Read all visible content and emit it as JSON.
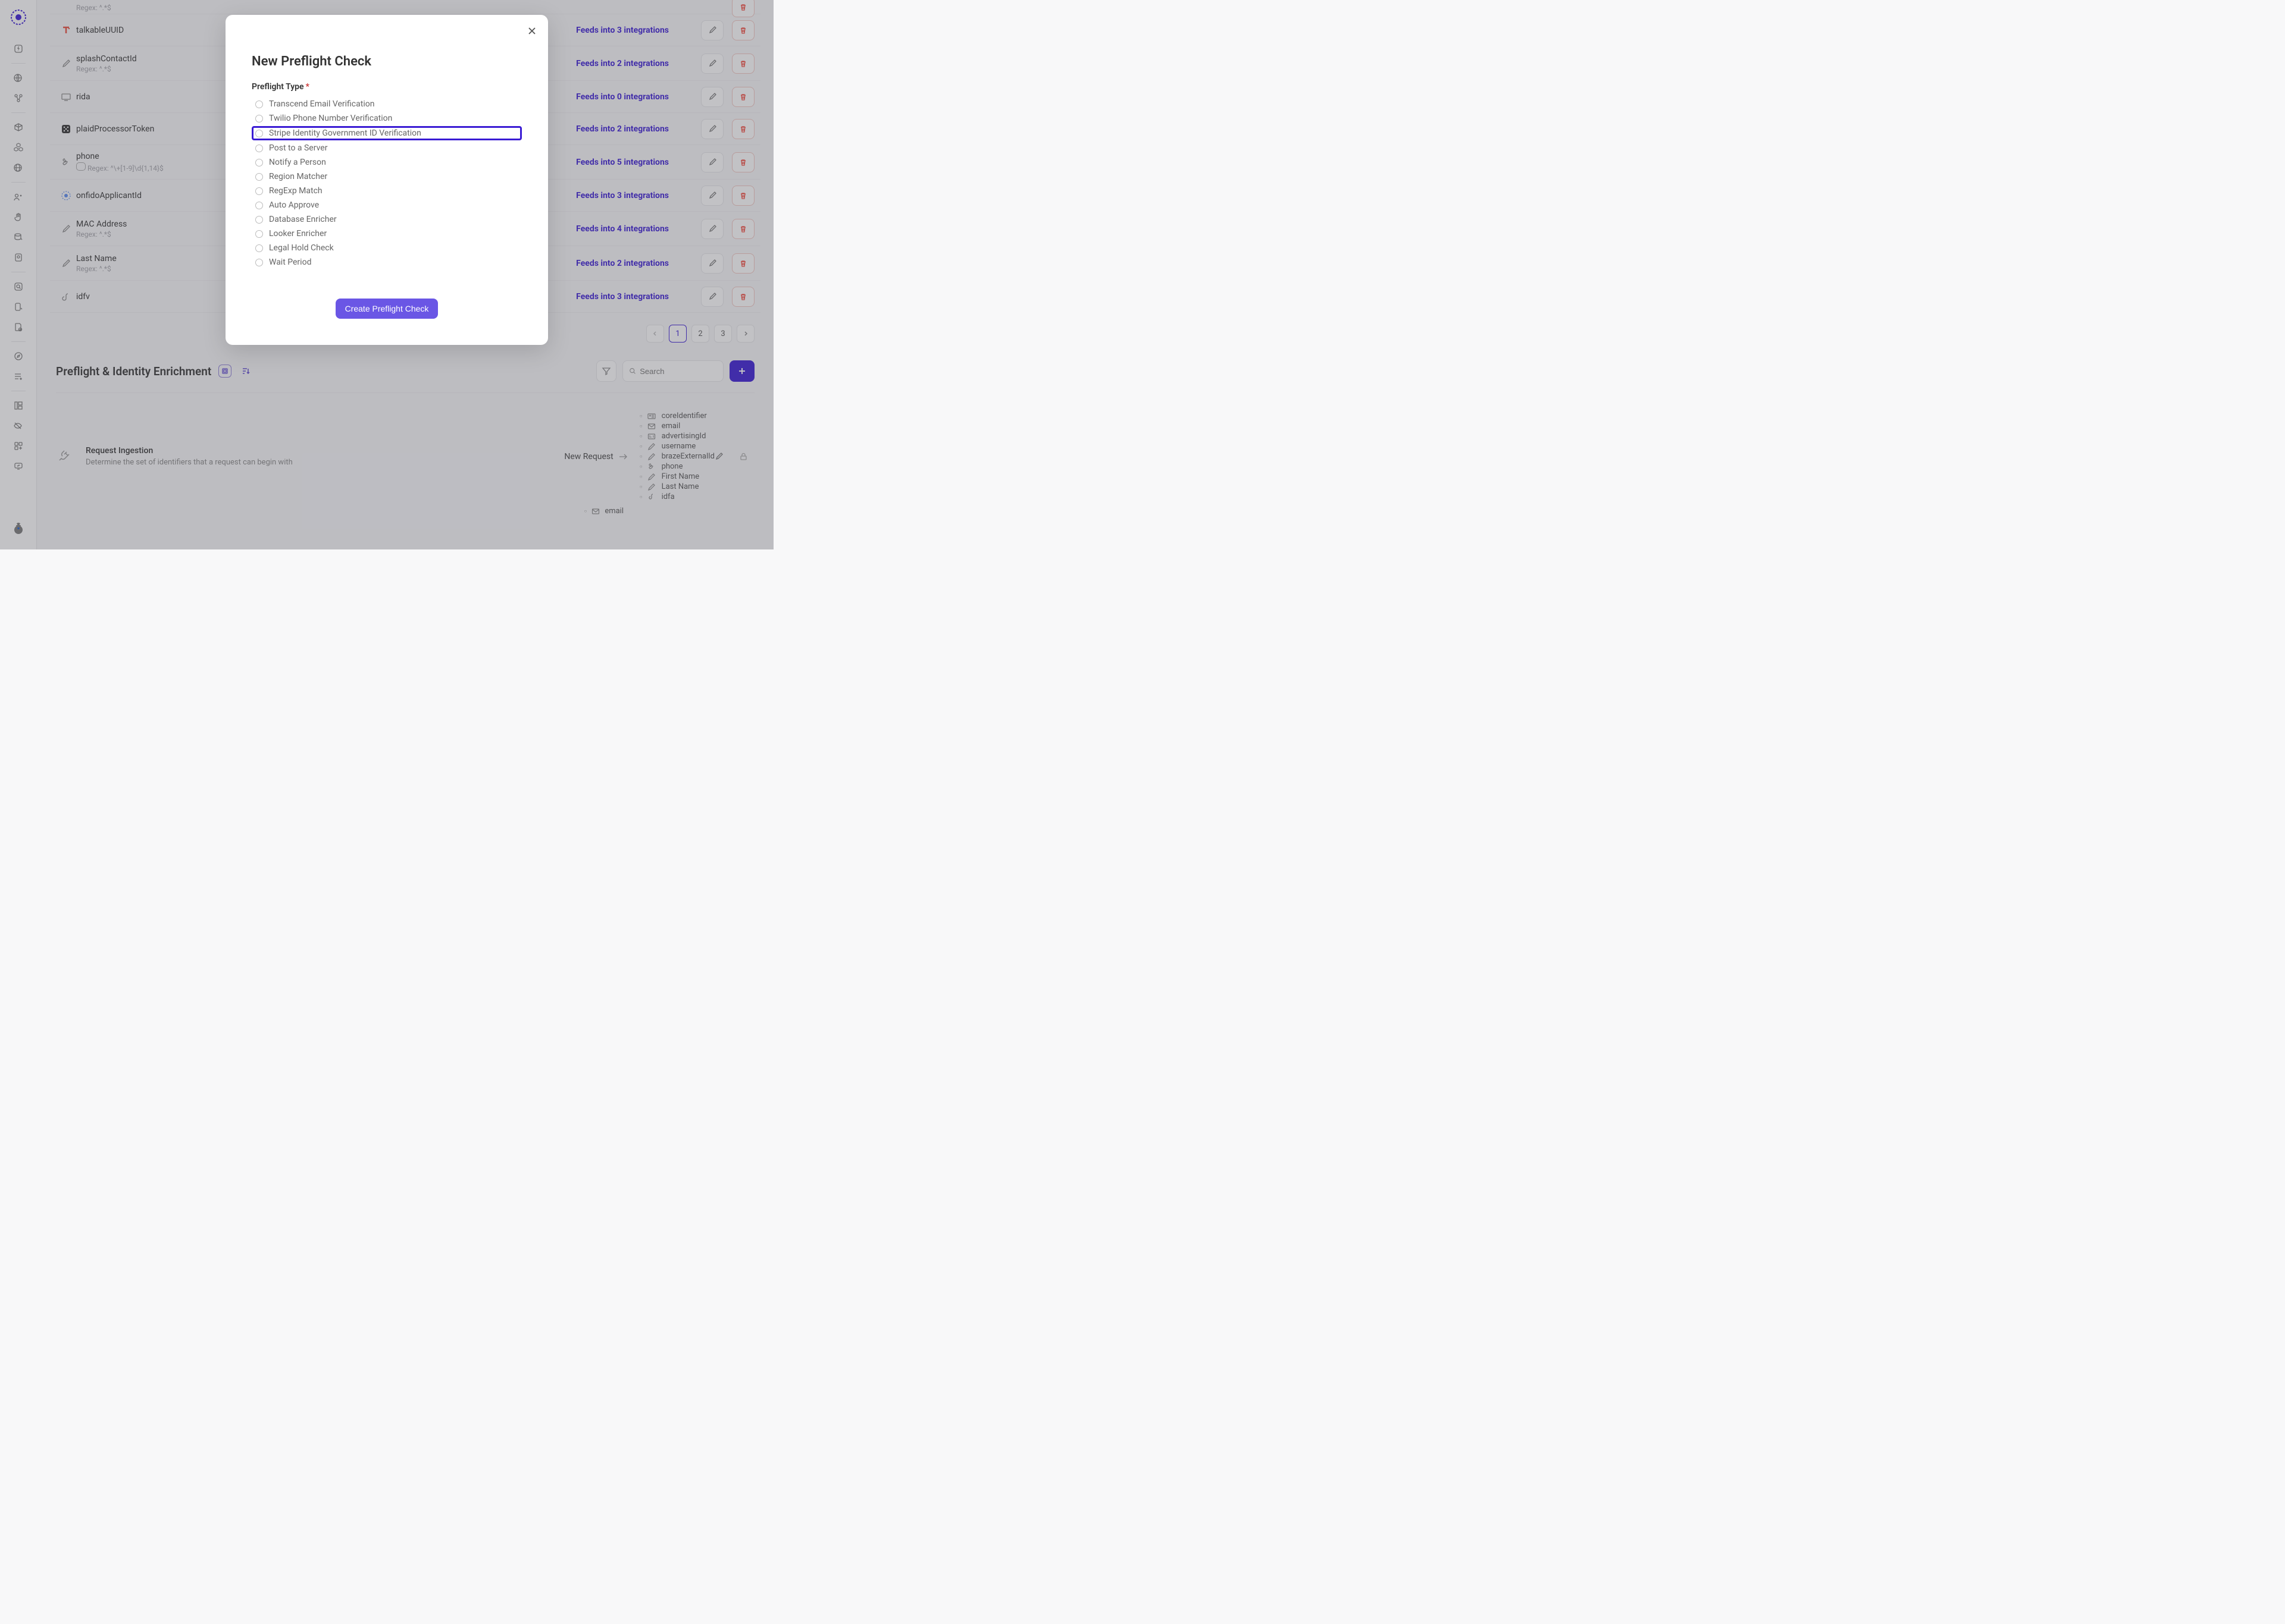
{
  "sidebar": {
    "bug_icon": "bug"
  },
  "rows": [
    {
      "title": "",
      "regex": "Regex: ^.*$",
      "feeds": ""
    },
    {
      "title": "talkableUUID",
      "regex": "",
      "feeds": "Feeds into 3 integrations"
    },
    {
      "title": "splashContactId",
      "regex": "Regex: ^.*$",
      "feeds": "Feeds into 2 integrations"
    },
    {
      "title": "rida",
      "regex": "",
      "feeds": "Feeds into 0 integrations"
    },
    {
      "title": "plaidProcessorToken",
      "regex": "",
      "feeds": "Feeds into 2 integrations"
    },
    {
      "title": "phone",
      "regex": "Regex: ^\\+[1-9]\\d{1,14}$",
      "feeds": "Feeds into 5 integrations"
    },
    {
      "title": "onfidoApplicantId",
      "regex": "",
      "feeds": "Feeds into 3 integrations"
    },
    {
      "title": "MAC Address",
      "regex": "Regex: ^.*$",
      "feeds": "Feeds into 4 integrations"
    },
    {
      "title": "Last Name",
      "regex": "Regex: ^.*$",
      "feeds": "Feeds into 2 integrations"
    },
    {
      "title": "idfv",
      "regex": "",
      "feeds": "Feeds into 3 integrations"
    }
  ],
  "pagination": {
    "pages": [
      "1",
      "2",
      "3"
    ],
    "active": "1"
  },
  "section": {
    "title": "Preflight & Identity Enrichment",
    "search_placeholder": "Search"
  },
  "ingestion": {
    "title": "Request Ingestion",
    "desc": "Determine the set of identifiers that a request can begin with",
    "new_request": "New Request",
    "bullets": [
      {
        "icon": "id",
        "label": "coreIdentifier"
      },
      {
        "icon": "mail",
        "label": "email"
      },
      {
        "icon": "ad",
        "label": "advertisingId"
      },
      {
        "icon": "pencil",
        "label": "username"
      },
      {
        "icon": "pencil",
        "label": "brazeExternalId"
      },
      {
        "icon": "phone",
        "label": "phone"
      },
      {
        "icon": "pencil",
        "label": "First Name"
      },
      {
        "icon": "pencil",
        "label": "Last Name"
      },
      {
        "icon": "apple",
        "label": "idfa"
      }
    ],
    "extra": {
      "icon": "mail",
      "label": "email"
    }
  },
  "modal": {
    "title": "New Preflight Check",
    "field_label": "Preflight Type",
    "options": [
      "Transcend Email Verification",
      "Twilio Phone Number Verification",
      "Stripe Identity Government ID Verification",
      "Post to a Server",
      "Notify a Person",
      "Region Matcher",
      "RegExp Match",
      "Auto Approve",
      "Database Enricher",
      "Looker Enricher",
      "Legal Hold Check",
      "Wait Period"
    ],
    "highlighted_index": 2,
    "create_btn": "Create Preflight Check"
  }
}
